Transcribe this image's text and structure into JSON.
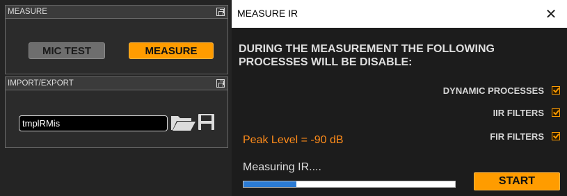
{
  "measure_panel": {
    "title": "MEASURE",
    "mic_test_label": "MIC TEST",
    "measure_label": "MEASURE"
  },
  "io_panel": {
    "title": "IMPORT/EXPORT",
    "filename": "tmplRMis"
  },
  "dialog": {
    "title": "MEASURE IR",
    "close_glyph": "✕",
    "notice": "DURING THE MEASUREMENT THE FOLLOWING PROCESSES WILL BE DISABLE:",
    "options": [
      {
        "label": "DYNAMIC PROCESSES",
        "checked": true
      },
      {
        "label": "IIR FILTERS",
        "checked": true
      },
      {
        "label": "FIR FILTERS",
        "checked": true
      }
    ],
    "peak_level": "Peak Level = -90 dB",
    "status": "Measuring IR....",
    "progress_percent": 25,
    "start_label": "START"
  },
  "colors": {
    "accent_orange": "#ff9c00",
    "peak_text": "#ff8c1a",
    "progress_blue": "#2b7bd4",
    "panel_bg": "#2b2b2b",
    "dialog_bg": "#1c1c1c"
  },
  "icons": [
    "float-window-icon",
    "folder-open-icon",
    "save-icon",
    "close-icon",
    "checkbox-checked-icon"
  ]
}
